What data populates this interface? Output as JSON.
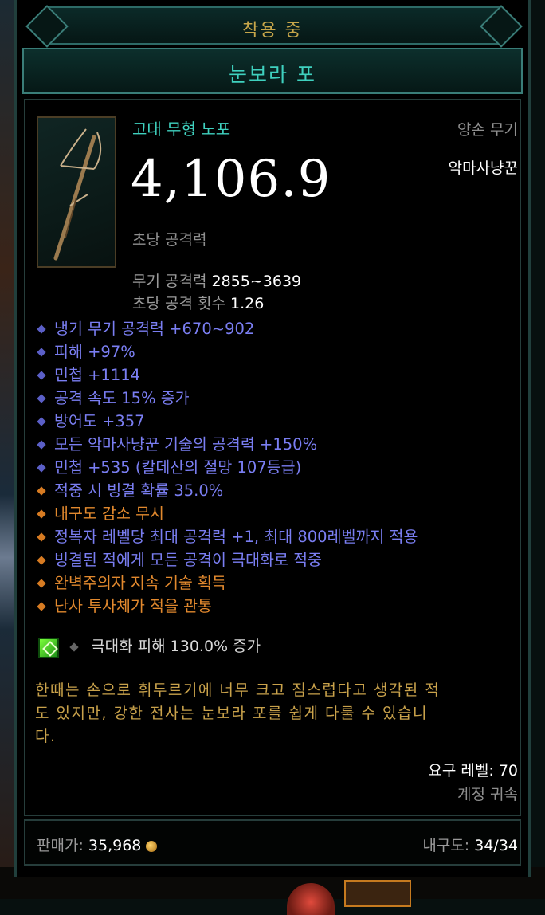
{
  "header": {
    "equipped_label": "착용 중",
    "item_name": "눈보라 포"
  },
  "item": {
    "quality_type": "고대 무형 노포",
    "slot": "양손 무기",
    "class_restriction": "악마사냥꾼",
    "dps_value": "4,106.9",
    "dps_label": "초당 공격력",
    "weapon_damage": {
      "label": "무기 공격력",
      "value": "2855~3639"
    },
    "attacks_per_second": {
      "label": "초당 공격 횟수",
      "value": "1.26"
    }
  },
  "affixes": [
    {
      "text": "냉기 무기 공격력 +670~902",
      "type": "primary",
      "color": "#7a7ef2"
    },
    {
      "text": "피해 +97%",
      "type": "primary",
      "color": "#7a7ef2"
    },
    {
      "text": "민첩 +1114",
      "type": "primary",
      "color": "#7a7ef2"
    },
    {
      "text": "공격 속도 15% 증가",
      "type": "primary",
      "color": "#7a7ef2"
    },
    {
      "text": "방어도 +357",
      "type": "primary",
      "color": "#7a7ef2"
    },
    {
      "text": "모든 악마사냥꾼 기술의 공격력 +150%",
      "type": "primary",
      "color": "#7a7ef2"
    },
    {
      "text": "민첩 +535 (칼데산의 절망 107등급)",
      "type": "primary",
      "color": "#7a7ef2"
    },
    {
      "text": "적중 시 빙결 확률 35.0%",
      "type": "legendary",
      "color": "#e2892e"
    },
    {
      "text": "내구도 감소 무시",
      "type": "legendary",
      "color": "#e2892e"
    },
    {
      "text": "정복자 레벨당 최대 공격력 +1, 최대 800레벨까지 적용",
      "type": "legendary",
      "color": "#e2892e"
    },
    {
      "text": "빙결된 적에게 모든 공격이 극대화로 적중",
      "type": "legendary",
      "color": "#e2892e"
    },
    {
      "text": "완벽주의자 지속 기술 획득",
      "type": "legendary",
      "color": "#e2892e"
    },
    {
      "text": "난사 투사체가 적을 관통",
      "type": "legendary",
      "color": "#e2892e"
    }
  ],
  "socket": {
    "icon": "green-gem-icon",
    "text": "극대화 피해 130.0% 증가"
  },
  "flavor": {
    "line1": "한때는 손으로 휘두르기에 너무 크고 짐스럽다고 생각된 적",
    "line2": "도 있지만, 강한 전사는 눈보라 포를 쉽게 다룰 수 있습니",
    "line3": "다."
  },
  "requirements": {
    "level_label": "요구 레벨:",
    "level_value": "70",
    "binding": "계정 귀속"
  },
  "footer": {
    "sell_label": "판매가:",
    "sell_value": "35,968",
    "durability_label": "내구도:",
    "durability_value": "34/34"
  },
  "colors": {
    "name_teal": "#3fd1bf",
    "equipped_gold": "#c7a64a",
    "affix_blue": "#7a7ef2",
    "affix_orange": "#e2892e",
    "flavor_gold": "#c9a24b"
  }
}
